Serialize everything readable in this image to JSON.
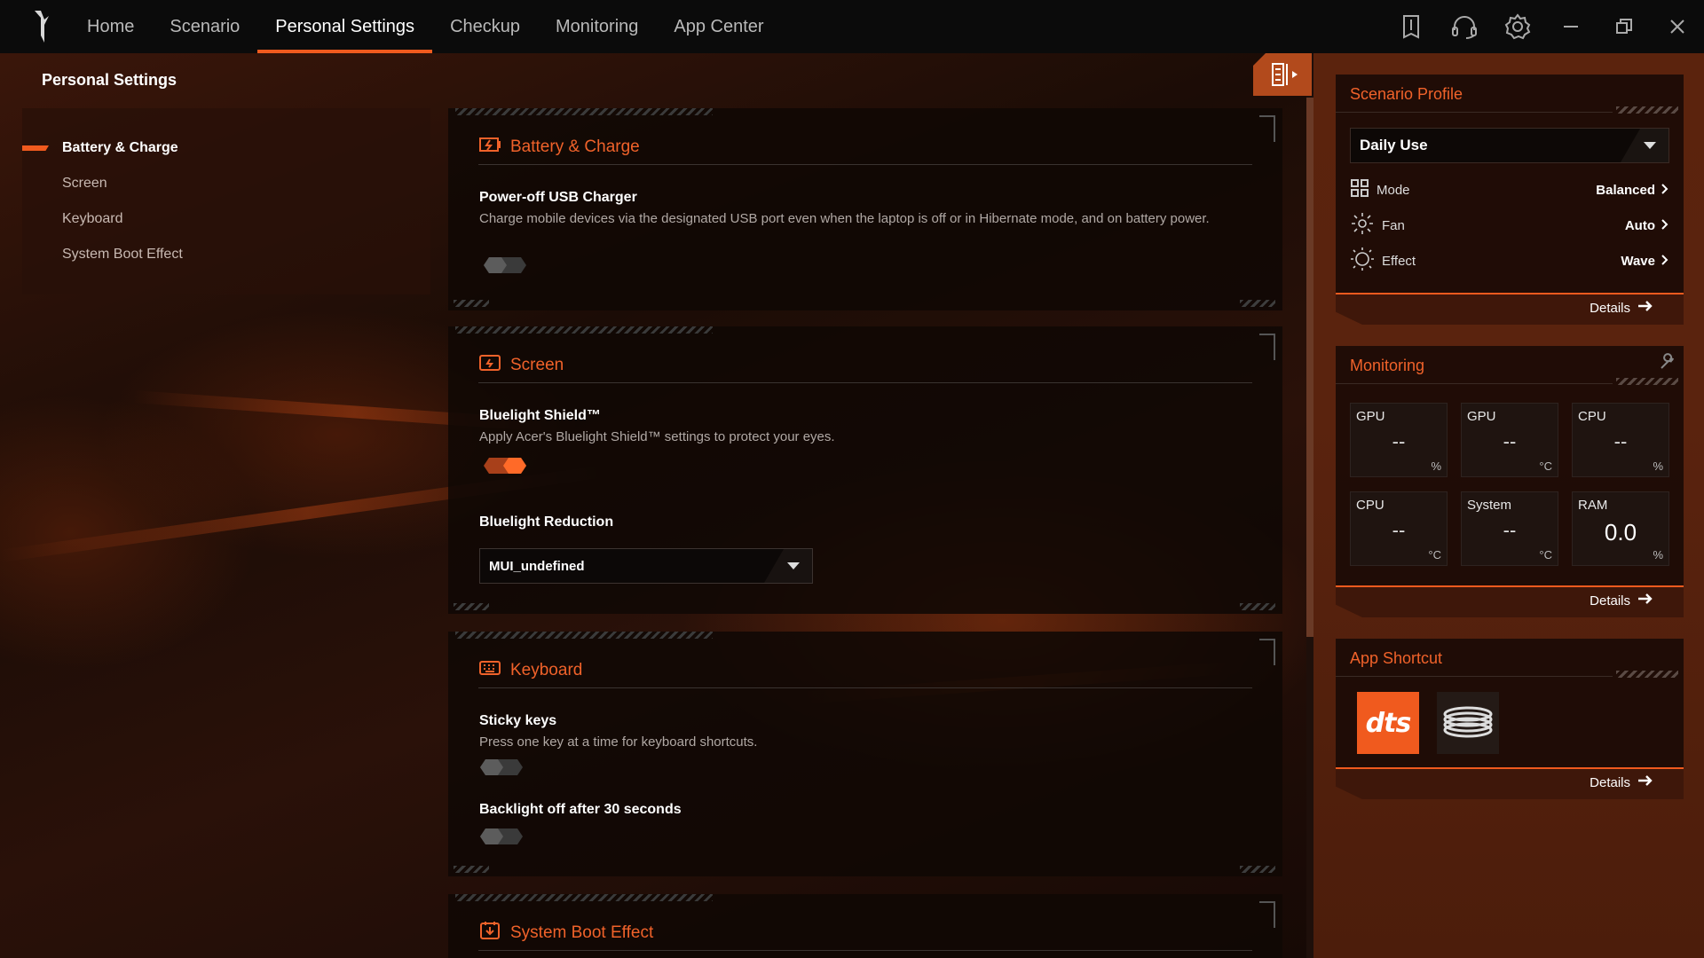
{
  "nav": {
    "items": [
      "Home",
      "Scenario",
      "Personal Settings",
      "Checkup",
      "Monitoring",
      "App Center"
    ],
    "active_index": 2
  },
  "window_icons": [
    "keyboard-icon",
    "headset-icon",
    "gear-icon",
    "minimize-icon",
    "restore-icon",
    "close-icon"
  ],
  "page": {
    "title": "Personal Settings",
    "menu": [
      "Battery & Charge",
      "Screen",
      "Keyboard",
      "System Boot Effect"
    ],
    "active_menu": 0
  },
  "battery": {
    "title": "Battery & Charge",
    "usb_name": "Power-off USB Charger",
    "usb_desc": "Charge mobile devices via the designated USB port even when the laptop is off or in Hibernate mode, and on battery power.",
    "usb_on": false
  },
  "screen": {
    "title": "Screen",
    "bluelight_name": "Bluelight Shield™",
    "bluelight_desc": "Apply Acer's Bluelight Shield™ settings to protect your eyes.",
    "bluelight_on": true,
    "reduction_name": "Bluelight Reduction",
    "reduction_value": "MUI_undefined"
  },
  "keyboard": {
    "title": "Keyboard",
    "sticky_name": "Sticky keys",
    "sticky_desc": "Press one key at a time for keyboard shortcuts.",
    "sticky_on": false,
    "backlight_name": "Backlight off after 30 seconds",
    "backlight_on": false
  },
  "boot": {
    "title": "System Boot Effect"
  },
  "scenario_profile": {
    "title": "Scenario Profile",
    "selected": "Daily Use",
    "rows": [
      {
        "label": "Mode",
        "value": "Balanced",
        "icon": "grid-icon"
      },
      {
        "label": "Fan",
        "value": "Auto",
        "icon": "fan-icon"
      },
      {
        "label": "Effect",
        "value": "Wave",
        "icon": "sun-icon"
      }
    ],
    "details": "Details"
  },
  "monitoring": {
    "title": "Monitoring",
    "tiles": [
      {
        "label": "GPU",
        "value": "--",
        "unit": "%"
      },
      {
        "label": "GPU",
        "value": "--",
        "unit": "°C"
      },
      {
        "label": "CPU",
        "value": "--",
        "unit": "%"
      },
      {
        "label": "CPU",
        "value": "--",
        "unit": "°C"
      },
      {
        "label": "System",
        "value": "--",
        "unit": "°C"
      },
      {
        "label": "RAM",
        "value": "0.0",
        "unit": "%"
      }
    ],
    "details": "Details"
  },
  "app_shortcut": {
    "title": "App Shortcut",
    "apps": [
      {
        "name": "dts",
        "icon": "dts-app-icon",
        "text": "dts"
      },
      {
        "name": "coil",
        "icon": "coil-app-icon"
      }
    ],
    "details": "Details"
  },
  "colors": {
    "accent": "#f05a1e",
    "panel": "#5b230d"
  }
}
